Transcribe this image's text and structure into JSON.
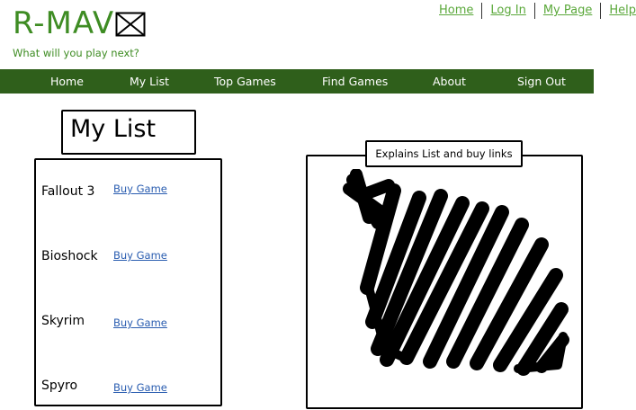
{
  "site": {
    "logo_text": "R-MAV",
    "logo_image_icon": "placeholder-image-icon",
    "tagline": "What will you play next?"
  },
  "top_links": [
    {
      "label": "Home"
    },
    {
      "label": "Log In"
    },
    {
      "label": "My Page"
    },
    {
      "label": "Help"
    }
  ],
  "colors": {
    "brand_green": "#3e8c23",
    "nav_background": "#2f5f1b",
    "link_blue": "#2a5db0"
  },
  "nav": [
    {
      "label": "Home"
    },
    {
      "label": "My List"
    },
    {
      "label": "Top Games"
    },
    {
      "label": "Find Games"
    },
    {
      "label": "About"
    },
    {
      "label": "Sign Out"
    }
  ],
  "page": {
    "title": "My List"
  },
  "games": [
    {
      "name": "Fallout 3",
      "link": "Buy Game"
    },
    {
      "name": "Bioshock",
      "link": "Buy Game"
    },
    {
      "name": "Skyrim",
      "link": "Buy Game"
    },
    {
      "name": "Spyro",
      "link": "Buy Game"
    }
  ],
  "note": {
    "label": "Explains List and buy links",
    "image_icon": "scribble-placeholder-icon"
  }
}
